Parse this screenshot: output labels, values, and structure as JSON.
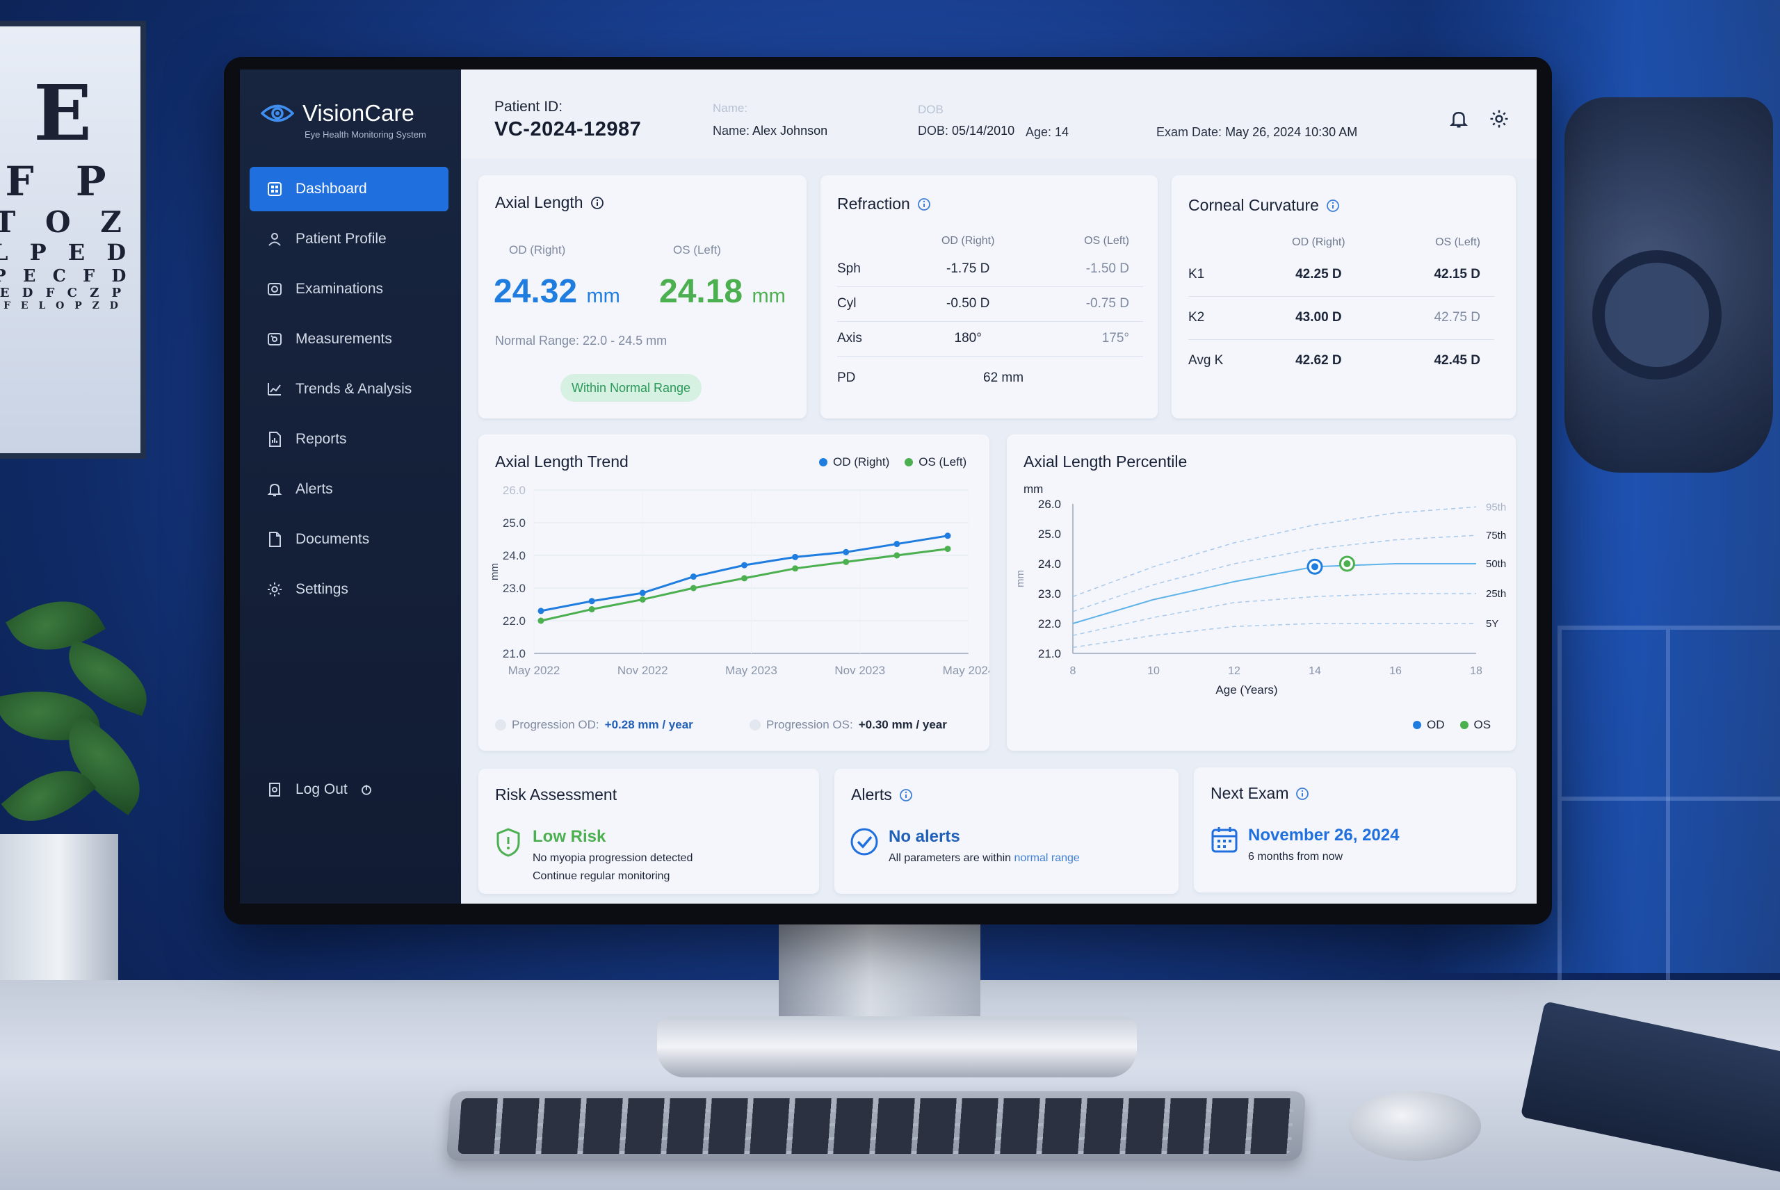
{
  "colors": {
    "accent": "#1f6fdf",
    "od": "#1f7de0",
    "os": "#4caf50",
    "sidebar": "#18253f"
  },
  "app": {
    "name": "VisionCare",
    "subtitle": "Eye Health Monitoring System"
  },
  "sidebar": {
    "items": [
      {
        "label": "Dashboard",
        "icon": "dashboard-icon",
        "active": true
      },
      {
        "label": "Patient Profile",
        "icon": "user-icon"
      },
      {
        "label": "Examinations",
        "icon": "camera-icon"
      },
      {
        "label": "Measurements",
        "icon": "ruler-icon"
      },
      {
        "label": "Trends & Analysis",
        "icon": "trend-icon"
      },
      {
        "label": "Reports",
        "icon": "report-icon"
      },
      {
        "label": "Alerts",
        "icon": "bell-icon"
      },
      {
        "label": "Documents",
        "icon": "document-icon"
      },
      {
        "label": "Settings",
        "icon": "gear-icon"
      }
    ],
    "logout": "Log Out"
  },
  "header": {
    "patient_id_label": "Patient ID:",
    "patient_id": "VC-2024-12987",
    "name_faint": "Name:",
    "name_label": "Name:",
    "name": "Alex Johnson",
    "dob_faint": "DOB",
    "dob_label": "DOB:",
    "dob": "05/14/2010",
    "age_label": "Age:",
    "age": "14",
    "exam_label": "Exam Date:",
    "exam_date": "May 26, 2024 10:30 AM"
  },
  "axial": {
    "title": "Axial Length",
    "od_label": "OD (Right)",
    "os_label": "OS (Left)",
    "od_value": "24.32",
    "os_value": "24.18",
    "unit": "mm",
    "range": "Normal Range: 22.0 - 24.5 mm",
    "status": "Within Normal Range"
  },
  "refraction": {
    "title": "Refraction",
    "col_od": "OD (Right)",
    "col_os": "OS (Left)",
    "rows": [
      {
        "label": "Sph",
        "od": "-1.75 D",
        "os": "-1.50 D"
      },
      {
        "label": "Cyl",
        "od": "-0.50 D",
        "os": "-0.75 D"
      },
      {
        "label": "Axis",
        "od": "180°",
        "os": "175°"
      }
    ],
    "pd_label": "PD",
    "pd_value": "62 mm"
  },
  "corneal": {
    "title": "Corneal Curvature",
    "col_od": "OD (Right)",
    "col_os": "OS (Left)",
    "rows": [
      {
        "label": "K1",
        "od": "42.25 D",
        "os": "42.15 D"
      },
      {
        "label": "K2",
        "od": "43.00 D",
        "os": "42.75 D"
      },
      {
        "label": "Avg K",
        "od": "42.62 D",
        "os": "42.45 D"
      }
    ]
  },
  "trend": {
    "title": "Axial Length Trend",
    "legend_od": "OD (Right)",
    "legend_os": "OS (Left)",
    "prog_od_label": "Progression OD:",
    "prog_od": "+0.28 mm / year",
    "prog_os_label": "Progression OS:",
    "prog_os": "+0.30 mm / year"
  },
  "percentile": {
    "title": "Axial Length Percentile",
    "legend_od": "OD",
    "legend_os": "OS"
  },
  "chart_data": [
    {
      "type": "line",
      "title": "Axial Length Trend",
      "ylabel": "mm",
      "ylim": [
        21.0,
        26.0
      ],
      "yticks": [
        "21.0",
        "22.0",
        "23.0",
        "24.0",
        "25.0",
        "26.0"
      ],
      "xticks": [
        "May 2022",
        "Nov 2022",
        "May 2023",
        "Nov 2023",
        "May 2024"
      ],
      "x": [
        0,
        0.5,
        1,
        1.5,
        2,
        2.5,
        3,
        3.5,
        4,
        4.5,
        5
      ],
      "grid": true,
      "legend": "top-right",
      "series": [
        {
          "name": "OD (Right)",
          "color": "#1f7de0",
          "values": [
            22.3,
            22.6,
            22.85,
            23.35,
            23.7,
            23.95,
            24.1,
            24.35,
            24.6
          ]
        },
        {
          "name": "OS (Left)",
          "color": "#4caf50",
          "values": [
            22.0,
            22.35,
            22.65,
            23.0,
            23.3,
            23.6,
            23.8,
            24.0,
            24.2
          ]
        }
      ]
    },
    {
      "type": "line",
      "title": "Axial Length Percentile",
      "xlabel": "Age (Years)",
      "ylabel": "mm",
      "ylim": [
        21.0,
        26.0
      ],
      "xlim": [
        8,
        18
      ],
      "yticks": [
        "21.0",
        "22.0",
        "23.0",
        "24.0",
        "25.0",
        "26.0"
      ],
      "xticks": [
        "8",
        "10",
        "12",
        "14",
        "16",
        "18"
      ],
      "percentile_labels": [
        "95th",
        "75th",
        "50th",
        "25th",
        "5Y"
      ],
      "percentile_curves": [
        {
          "label": "95th",
          "values": [
            [
              8,
              22.9
            ],
            [
              10,
              23.9
            ],
            [
              12,
              24.7
            ],
            [
              14,
              25.3
            ],
            [
              16,
              25.7
            ],
            [
              18,
              25.9
            ]
          ]
        },
        {
          "label": "75th",
          "values": [
            [
              8,
              22.4
            ],
            [
              10,
              23.3
            ],
            [
              12,
              24.0
            ],
            [
              14,
              24.5
            ],
            [
              16,
              24.8
            ],
            [
              18,
              24.95
            ]
          ]
        },
        {
          "label": "50th",
          "values": [
            [
              8,
              22.0
            ],
            [
              10,
              22.8
            ],
            [
              12,
              23.4
            ],
            [
              14,
              23.9
            ],
            [
              16,
              24.0
            ],
            [
              18,
              24.0
            ]
          ]
        },
        {
          "label": "25th",
          "values": [
            [
              8,
              21.6
            ],
            [
              10,
              22.2
            ],
            [
              12,
              22.7
            ],
            [
              14,
              22.9
            ],
            [
              16,
              23.0
            ],
            [
              18,
              23.0
            ]
          ]
        },
        {
          "label": "5Y",
          "values": [
            [
              8,
              21.2
            ],
            [
              10,
              21.6
            ],
            [
              12,
              21.9
            ],
            [
              14,
              22.0
            ],
            [
              16,
              22.0
            ],
            [
              18,
              22.0
            ]
          ]
        }
      ],
      "series": [
        {
          "name": "OD",
          "color": "#1f7de0",
          "points": [
            [
              14,
              23.9
            ]
          ]
        },
        {
          "name": "OS",
          "color": "#4caf50",
          "points": [
            [
              14.8,
              24.0
            ]
          ]
        }
      ],
      "legend": "bottom-right"
    }
  ],
  "risk": {
    "title": "Risk Assessment",
    "status": "Low Risk",
    "line1": "No myopia progression detected",
    "line2": "Continue regular monitoring"
  },
  "alerts": {
    "title": "Alerts",
    "status": "No alerts",
    "line1": "All parameters are within",
    "line1_highlight": "normal range"
  },
  "next_exam": {
    "title": "Next Exam",
    "date": "November 26, 2024",
    "sub": "6 months from now"
  }
}
